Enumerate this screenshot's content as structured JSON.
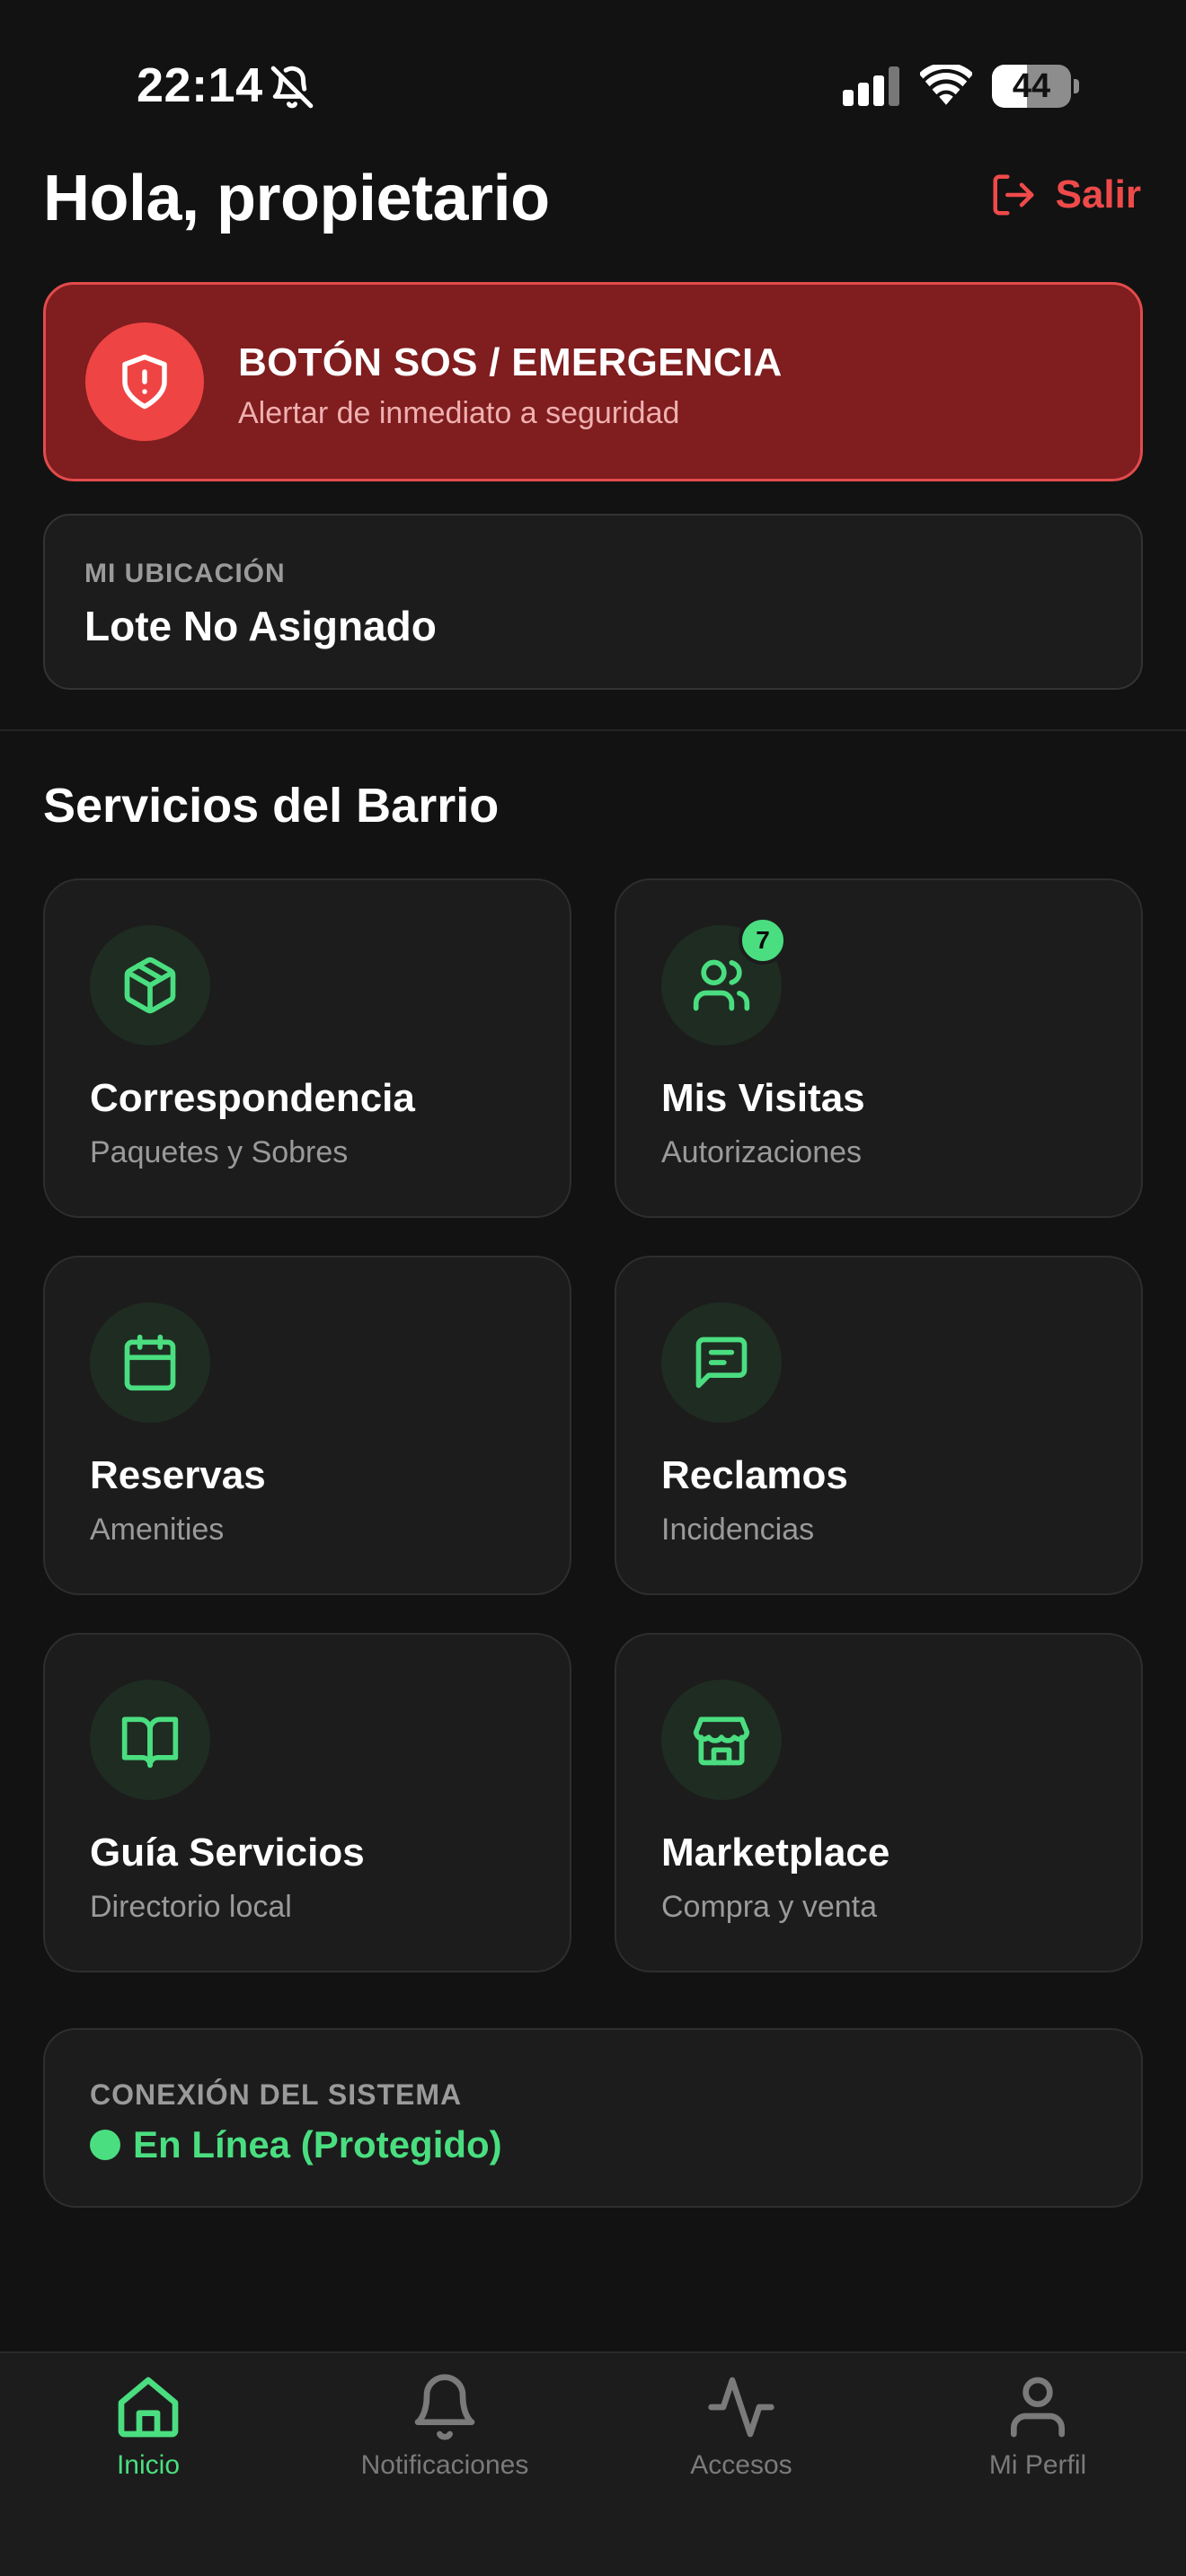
{
  "status_bar": {
    "time": "22:14",
    "battery_percent": "44",
    "battery_level": 0.44
  },
  "header": {
    "greeting": "Hola, propietario",
    "logout_label": "Salir"
  },
  "sos": {
    "title": "BOTÓN SOS / EMERGENCIA",
    "subtitle": "Alertar de inmediato a seguridad"
  },
  "location": {
    "label": "MI UBICACIÓN",
    "value": "Lote No Asignado"
  },
  "services": {
    "title": "Servicios del Barrio",
    "items": [
      {
        "title": "Correspondencia",
        "subtitle": "Paquetes y Sobres",
        "icon": "package-icon"
      },
      {
        "title": "Mis Visitas",
        "subtitle": "Autorizaciones",
        "icon": "users-icon",
        "badge": "7"
      },
      {
        "title": "Reservas",
        "subtitle": "Amenities",
        "icon": "calendar-icon"
      },
      {
        "title": "Reclamos",
        "subtitle": "Incidencias",
        "icon": "message-icon"
      },
      {
        "title": "Guía Servicios",
        "subtitle": "Directorio local",
        "icon": "book-icon"
      },
      {
        "title": "Marketplace",
        "subtitle": "Compra y venta",
        "icon": "store-icon"
      }
    ]
  },
  "connection": {
    "label": "CONEXIÓN DEL SISTEMA",
    "status": "En Línea (Protegido)"
  },
  "nav": {
    "items": [
      {
        "label": "Inicio",
        "icon": "home-icon",
        "active": true
      },
      {
        "label": "Notificaciones",
        "icon": "bell-icon",
        "active": false
      },
      {
        "label": "Accesos",
        "icon": "activity-icon",
        "active": false
      },
      {
        "label": "Mi Perfil",
        "icon": "user-icon",
        "active": false
      }
    ]
  },
  "colors": {
    "background": "#121212",
    "card": "#1c1c1c",
    "accent_green": "#4ade80",
    "danger_red": "#ef4444",
    "sos_background": "#7f1d1f"
  }
}
